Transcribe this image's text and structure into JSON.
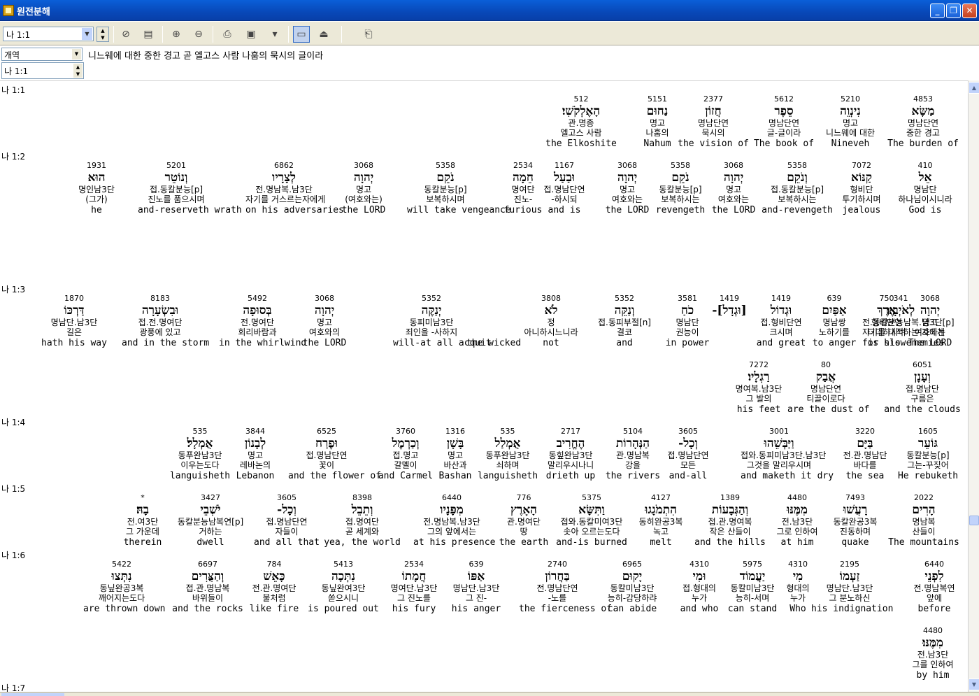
{
  "window": {
    "title": "원전분해"
  },
  "toolbar": {
    "verse_value": "나 1:1"
  },
  "header": {
    "version_value": "개역",
    "verse_text": "니느웨에 대한 중한 경고 곧 엘고스 사람 나훔의 묵시의 글이라",
    "ref_value": "나 1:1"
  },
  "verses": [
    {
      "ref": "나 1:1",
      "words": [
        {
          "num": "512",
          "heb": "הָאֶלְקֹשִׁי׃",
          "parse": "관.명종",
          "kor": "엘고스 사람",
          "eng": "the Elkoshite"
        },
        {
          "num": "5151",
          "heb": "נַחוּם",
          "parse": "명고",
          "kor": "나훔의",
          "eng": "Nahum"
        },
        {
          "num": "2377",
          "heb": "חֲזוֹן",
          "parse": "명남단연",
          "kor": "묵시의",
          "eng": "the vision of"
        },
        {
          "num": "5612",
          "heb": "סֵפֶר",
          "parse": "명남단연",
          "kor": "글-글이라",
          "eng": "The book of"
        },
        {
          "num": "5210",
          "heb": "נִינְוֵה",
          "parse": "명고",
          "kor": "니느웨에 대한",
          "eng": "Nineveh"
        },
        {
          "num": "4853",
          "heb": "מַשָּׂא",
          "parse": "명남단연",
          "kor": "중한 경고",
          "eng": "The burden of"
        }
      ]
    },
    {
      "ref": "나 1:2",
      "words": [
        {
          "num": "1931",
          "heb": "הוּא",
          "parse": "명인남3단",
          "kor": "(그가)",
          "eng": "he"
        },
        {
          "num": "5201",
          "heb": "וְנוֹטֵר",
          "parse": "접.동칼분능[p]",
          "kor": "진노를 품으시며",
          "eng": "and-reserveth wrath"
        },
        {
          "num": "6862",
          "heb": "לְצָרָיו",
          "parse": "전.명남복.남3단",
          "kor": "자기를 거스르는자에게",
          "eng": "on his adversaries"
        },
        {
          "num": "3068",
          "heb": "יְהוָה",
          "parse": "명고",
          "kor": "(여호와는)",
          "eng": "the LORD"
        },
        {
          "num": "5358",
          "heb": "נֹקֵם",
          "parse": "동칼분능[p]",
          "kor": "보복하시며",
          "eng": "will take vengeance"
        },
        {
          "num": "2534",
          "heb": "חֵמָה",
          "parse": "명여단",
          "kor": "진노-",
          "eng": "furious"
        },
        {
          "num": "1167",
          "heb": "וּבַעַל",
          "parse": "접.명남단연",
          "kor": "-하시되",
          "eng": "and is"
        },
        {
          "num": "3068",
          "heb": "יְהוָה",
          "parse": "명고",
          "kor": "여호와는",
          "eng": "the LORD"
        },
        {
          "num": "5358",
          "heb": "נֹקֵם",
          "parse": "동칼분능[p]",
          "kor": "보복하시는",
          "eng": "revengeth"
        },
        {
          "num": "3068",
          "heb": "יְהוָה",
          "parse": "명고",
          "kor": "여호와는",
          "eng": "the LORD"
        },
        {
          "num": "5358",
          "heb": "וְנֹקֵם",
          "parse": "접.동칼분능[p]",
          "kor": "보복하시는",
          "eng": "and-revengeth"
        },
        {
          "num": "7072",
          "heb": "קַנּוֹא",
          "parse": "형비단",
          "kor": "투기하시며",
          "eng": "jealous"
        },
        {
          "num": "410",
          "heb": "אֵל",
          "parse": "명남단",
          "kor": "하나님이시니라",
          "eng": "God is"
        },
        {
          "num": "341",
          "heb": "לְאֹיְבָיו׃",
          "parse": "전.동칼분능남복.남3단[p]",
          "kor": "자기를 대적하는 자에게",
          "eng": "for his enemies"
        }
      ]
    },
    {
      "ref": "나 1:3",
      "words": [
        {
          "num": "1870",
          "heb": "דַּרְכּוֹ",
          "parse": "명남단.남3단",
          "kor": "길은",
          "eng": "hath his way"
        },
        {
          "num": "8183",
          "heb": "וּבִשְׂעָרָה",
          "parse": "접.전.명여단",
          "kor": "광풍에 있고",
          "eng": "and in the storm"
        },
        {
          "num": "5492",
          "heb": "בְּסוּפָה",
          "parse": "전.명여단",
          "kor": "회리바람과",
          "eng": "in the whirlwind"
        },
        {
          "num": "3068",
          "heb": "יְהוָה",
          "parse": "명고",
          "kor": "여호와의",
          "eng": "the LORD"
        },
        {
          "num": "5352",
          "heb": "יְנַקֶּה",
          "parse": "동피미남3단",
          "kor": "죄인을 -사하지",
          "eng": "will-at all acquit"
        },
        {
          "num": "",
          "heb": "",
          "parse": "",
          "kor": "",
          "eng": "the wicked"
        },
        {
          "num": "3808",
          "heb": "לֹא",
          "parse": "정",
          "kor": "아니하시느니라",
          "eng": "not"
        },
        {
          "num": "5352",
          "heb": "וְנַקֵּה",
          "parse": "접.동피부절[n]",
          "kor": "결코",
          "eng": "and"
        },
        {
          "num": "3581",
          "heb": "כֹחַ",
          "parse": "명남단",
          "kor": "권능이",
          "eng": "in power"
        },
        {
          "num": "1419",
          "heb": "[וּגְדָל]-",
          "parse": "",
          "kor": "",
          "eng": ""
        },
        {
          "num": "1419",
          "heb": "וּגְדוֹל",
          "parse": "접.형비단연",
          "kor": "크시며",
          "eng": "and great"
        },
        {
          "num": "639",
          "heb": "אַפַּיִם",
          "parse": "명남쌍",
          "kor": "노하기를",
          "eng": "to anger"
        },
        {
          "num": "750",
          "heb": "אֶרֶךְ",
          "parse": "형비단연",
          "kor": "더디하시며",
          "eng": "is slow"
        },
        {
          "num": "3068",
          "heb": "יְהוָה",
          "parse": "명고",
          "kor": "여호와는",
          "eng": "The LORD"
        },
        {
          "num": "7272",
          "heb": "רַגְלָיו׃",
          "parse": "명여복.남3단",
          "kor": "그 발의",
          "eng": "his feet"
        },
        {
          "num": "80",
          "heb": "אֲבַק",
          "parse": "명남단연",
          "kor": "티끌이로다",
          "eng": "are the dust of"
        },
        {
          "num": "6051",
          "heb": "וְעָנָן",
          "parse": "접.명남단",
          "kor": "구름은",
          "eng": "and the clouds"
        }
      ]
    },
    {
      "ref": "나 1:4",
      "words": [
        {
          "num": "535",
          "heb": "אֻמְלָל׃",
          "parse": "동푸완남3단",
          "kor": "이우는도다",
          "eng": "languisheth"
        },
        {
          "num": "3844",
          "heb": "לְבָנוֹן",
          "parse": "명고",
          "kor": "레바논의",
          "eng": "Lebanon"
        },
        {
          "num": "6525",
          "heb": "וּפֶרַח",
          "parse": "접.명남단연",
          "kor": "꽃이",
          "eng": "and the flower of"
        },
        {
          "num": "3760",
          "heb": "וְכַרְמֶל",
          "parse": "접.명고",
          "kor": "갈멜이",
          "eng": "and Carmel"
        },
        {
          "num": "1316",
          "heb": "בָּשָׁן",
          "parse": "명고",
          "kor": "바산과",
          "eng": "Bashan"
        },
        {
          "num": "535",
          "heb": "אֻמְלַל",
          "parse": "동푸완남3단",
          "kor": "쇠하며",
          "eng": "languisheth"
        },
        {
          "num": "2717",
          "heb": "הֶחֱרִיב",
          "parse": "동힢완남3단",
          "kor": "말리우시나니",
          "eng": "drieth up"
        },
        {
          "num": "5104",
          "heb": "הַנְּהָרוֹת",
          "parse": "관.명남복",
          "kor": "강을",
          "eng": "the rivers"
        },
        {
          "num": "3605",
          "heb": "וְכָל-",
          "parse": "접.명남단연",
          "kor": "모든",
          "eng": "and-all"
        },
        {
          "num": "3001",
          "heb": "וַיַּבְּשֵׁהוּ",
          "parse": "접와.동피미남3단.남3단",
          "kor": "그것을 말리우시며",
          "eng": "and maketh it dry"
        },
        {
          "num": "3220",
          "heb": "בַּיָּם",
          "parse": "전.관.명남단",
          "kor": "바다를",
          "eng": "the sea"
        },
        {
          "num": "1605",
          "heb": "גּוֹעֵר",
          "parse": "동칼분능[p]",
          "kor": "그는-꾸짖어",
          "eng": "He rebuketh"
        }
      ]
    },
    {
      "ref": "나 1:5",
      "words": [
        {
          "num": "*",
          "heb": "בָהּ׃",
          "parse": "전.여3단",
          "kor": "그 가운데",
          "eng": "therein"
        },
        {
          "num": "3427",
          "heb": "יֹשְׁבֵי",
          "parse": "동칼분능남복연[p]",
          "kor": "거하는",
          "eng": "dwell"
        },
        {
          "num": "3605",
          "heb": "וְכָל-",
          "parse": "접.명남단연",
          "kor": "자들이",
          "eng": "and all that"
        },
        {
          "num": "8398",
          "heb": "וְתֵבֵל",
          "parse": "접.명여단",
          "kor": "곧 세계와",
          "eng": "yea, the world"
        },
        {
          "num": "6440",
          "heb": "מִפָּנָיו",
          "parse": "전.명남복.남3단",
          "kor": "그의 앞에서는",
          "eng": "at his presence"
        },
        {
          "num": "776",
          "heb": "הָאָרֶץ",
          "parse": "관.명여단",
          "kor": "땅",
          "eng": "the earth"
        },
        {
          "num": "5375",
          "heb": "וַתִּשָּׂא",
          "parse": "접와.동칼미여3단",
          "kor": "솟아 오르는도다",
          "eng": "and-is burned"
        },
        {
          "num": "4127",
          "heb": "הִתְמֹגָגוּ",
          "parse": "동히완공3복",
          "kor": "녹고",
          "eng": "melt"
        },
        {
          "num": "1389",
          "heb": "וְהַגְּבָעוֹת",
          "parse": "접.관.명여복",
          "kor": "작은 산들이",
          "eng": "and the hills"
        },
        {
          "num": "4480",
          "heb": "מִמֶּנּוּ",
          "parse": "전.남3단",
          "kor": "그로 인하여",
          "eng": "at him"
        },
        {
          "num": "7493",
          "heb": "רָעֲשׁוּ",
          "parse": "동칼완공3복",
          "kor": "진동하며",
          "eng": "quake"
        },
        {
          "num": "2022",
          "heb": "הָרִים",
          "parse": "명남복",
          "kor": "산들이",
          "eng": "The mountains"
        }
      ]
    },
    {
      "ref": "나 1:6",
      "words": [
        {
          "num": "5422",
          "heb": "נִתְּצוּ",
          "parse": "동닢완공3복",
          "kor": "깨어지는도다",
          "eng": "are thrown down"
        },
        {
          "num": "6697",
          "heb": "וְהַצֻּרִים",
          "parse": "접.관.명남복",
          "kor": "바위들이",
          "eng": "and the rocks"
        },
        {
          "num": "784",
          "heb": "כָּאֵשׁ",
          "parse": "전.관.명여단",
          "kor": "불처럼",
          "eng": "like fire"
        },
        {
          "num": "5413",
          "heb": "נִתְּכָה",
          "parse": "동닢완여3단",
          "kor": "쏟으시니",
          "eng": "is poured out"
        },
        {
          "num": "2534",
          "heb": "חֲמָתוֹ",
          "parse": "명여단.남3단",
          "kor": "그 진노를",
          "eng": "his fury"
        },
        {
          "num": "639",
          "heb": "אַפּוֹ",
          "parse": "명남단.남3단",
          "kor": "그 진-",
          "eng": "his anger"
        },
        {
          "num": "2740",
          "heb": "בַּחֲרוֹן",
          "parse": "전.명남단연",
          "kor": "-노를",
          "eng": "the fierceness of"
        },
        {
          "num": "6965",
          "heb": "יָקוּם",
          "parse": "동칼미남3단",
          "kor": "능히-감당하랴",
          "eng": "can abide"
        },
        {
          "num": "4310",
          "heb": "וּמִי",
          "parse": "접.형대의",
          "kor": "누가",
          "eng": "and who"
        },
        {
          "num": "5975",
          "heb": "יַעֲמוֹד",
          "parse": "동칼미남3단",
          "kor": "능히-서며",
          "eng": "can stand"
        },
        {
          "num": "4310",
          "heb": "מִי",
          "parse": "형대의",
          "kor": "누가",
          "eng": "Who"
        },
        {
          "num": "2195",
          "heb": "זַעְמוֹ",
          "parse": "명남단.남3단",
          "kor": "그 분노하신",
          "eng": "his indignation"
        },
        {
          "num": "6440",
          "heb": "לִפְנֵי",
          "parse": "전.명남복연",
          "kor": "앞에",
          "eng": "before"
        },
        {
          "num": "4480",
          "heb": "מִמֶּנּוּ׃",
          "parse": "전.남3단",
          "kor": "그를 인하여",
          "eng": "by him"
        }
      ]
    },
    {
      "ref": "나 1:7",
      "words": []
    }
  ]
}
